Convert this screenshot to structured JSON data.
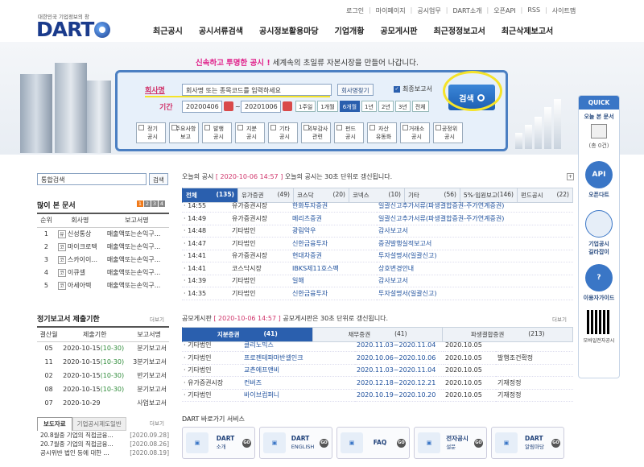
{
  "topbar": [
    "로그인",
    "마이페이지",
    "공시업무",
    "DART소개",
    "오픈API",
    "RSS",
    "사이트맵"
  ],
  "logo": {
    "sub": "대한민국 기업정보의 창",
    "name": "DART"
  },
  "nav": [
    "최근공시",
    "공시서류검색",
    "공시정보활용마당",
    "기업개황",
    "공모게시판",
    "최근정정보고서",
    "최근삭제보고서"
  ],
  "slogan": {
    "h1": "신속하고",
    "h2": "투명한 공시 !",
    "rest": "세계속의 초일류 자본시장을 만들어 나갑니다."
  },
  "search": {
    "company_label": "회사명",
    "company_value": "회사명 또는 종목코드를 입력하세요",
    "find_btn": "회사명찾기",
    "final_label": "최종보고서",
    "period_label": "기간",
    "start": "20200406",
    "end": "20201006",
    "periods": [
      "1주일",
      "1개월",
      "6개월",
      "1년",
      "2년",
      "3년",
      "전체"
    ],
    "periods_active": 2,
    "categories": [
      "정기\n공시",
      "주요사항\n보고",
      "발행\n공시",
      "지분\n공시",
      "기타\n공시",
      "외부감사\n관련",
      "펀드\n공시",
      "자산\n유동화",
      "거래소\n공시",
      "공정위\n공시"
    ],
    "search_btn": "검색"
  },
  "quick": {
    "title": "QUICK",
    "recent": "오늘 본 문서",
    "count": "(총 0건)",
    "api": "API",
    "api_label": "오픈다트",
    "guide1": "기업공시",
    "guide2": "길라잡이",
    "faq": "이용자가이드",
    "mobile": "모바일전자공시"
  },
  "left": {
    "search_value": "통합검색",
    "search_btn": "검색",
    "top_title": "많이 본 문서",
    "pages": [
      "1",
      "2",
      "3",
      "4"
    ],
    "top_cols": [
      "순위",
      "회사명",
      "보고서명"
    ],
    "top_rows": [
      {
        "rank": "1",
        "mk": "유",
        "co": "신성통상",
        "rep": "매출액또는손익구..."
      },
      {
        "rank": "2",
        "mk": "코",
        "co": "마이크로텍",
        "rep": "매출액또는손익구..."
      },
      {
        "rank": "3",
        "mk": "코",
        "co": "스카이이...",
        "rep": "매출액또는손익구..."
      },
      {
        "rank": "4",
        "mk": "코",
        "co": "이큐셀",
        "rep": "매출액또는손익구..."
      },
      {
        "rank": "5",
        "mk": "코",
        "co": "아세아텍",
        "rep": "매출액또는손익구..."
      }
    ],
    "deadline_title": "정기보고서 제출기한",
    "more": "더보기",
    "dl_cols": [
      "결산월",
      "제출기한",
      "보고서명"
    ],
    "dl_rows": [
      {
        "m": "05",
        "d": "2020-10-15",
        "t": "(10-30)",
        "r": "분기보고서"
      },
      {
        "m": "11",
        "d": "2020-10-15",
        "t": "(10-30)",
        "r": "3분기보고서"
      },
      {
        "m": "02",
        "d": "2020-10-15",
        "t": "(10-30)",
        "r": "반기보고서"
      },
      {
        "m": "08",
        "d": "2020-10-15",
        "t": "(10-30)",
        "r": "분기보고서"
      },
      {
        "m": "07",
        "d": "2020-10-29",
        "t": "",
        "r": "사업보고서"
      }
    ],
    "news_tabs": [
      "보도자료",
      "기업공시제도일반"
    ],
    "news": [
      {
        "t": "20.8월중 기업의 직접금융...",
        "d": "[2020.09.28]"
      },
      {
        "t": "20.7월중 기업의 직접금융...",
        "d": "[2020.08.26]"
      },
      {
        "t": "공시위반 법인 등에 대한 ...",
        "d": "[2020.08.19]"
      }
    ]
  },
  "today": {
    "title": "오늘의 공시",
    "stamp": "[ 2020-10-06 14:57 ]",
    "desc": "오늘의 공시는 30초 단위로 갱신됩니다.",
    "tabs": [
      {
        "n": "전체",
        "c": "(135)"
      },
      {
        "n": "유가증권",
        "c": "(49)"
      },
      {
        "n": "코스닥",
        "c": "(20)"
      },
      {
        "n": "코넥스",
        "c": "(10)"
      },
      {
        "n": "기타",
        "c": "(56)"
      },
      {
        "n": "5%·임원보고",
        "c": "(146)"
      },
      {
        "n": "펀드공시",
        "c": "(22)"
      }
    ],
    "rows": [
      {
        "time": "14:55",
        "mkt": "유가증권시장",
        "co": "한화투자증권",
        "rep": "일괄신고추가서류(파생결합증권-주가연계증권)"
      },
      {
        "time": "14:49",
        "mkt": "유가증권시장",
        "co": "메리츠증권",
        "rep": "일괄신고추가서류(파생결합증권-주가연계증권)"
      },
      {
        "time": "14:48",
        "mkt": "기타법인",
        "co": "광림악우",
        "rep": "감사보고서"
      },
      {
        "time": "14:47",
        "mkt": "기타법인",
        "co": "신한금융투자",
        "rep": "증권발행실적보고서"
      },
      {
        "time": "14:41",
        "mkt": "유가증권시장",
        "co": "현대차증권",
        "rep": "투자설명서(일괄신고)"
      },
      {
        "time": "14:41",
        "mkt": "코스닥시장",
        "co": "IBKS제11호스팩",
        "rep": "상호변경안내"
      },
      {
        "time": "14:39",
        "mkt": "기타법인",
        "co": "일해",
        "rep": "감사보고서"
      },
      {
        "time": "14:35",
        "mkt": "기타법인",
        "co": "신한금융투자",
        "rep": "투자설명서(일괄신고)"
      }
    ]
  },
  "ipo": {
    "title": "공모게시판",
    "stamp": "[ 2020-10-06 14:57 ]",
    "desc": "공모게시판은 30초 단위로 갱신됩니다.",
    "tabs": [
      {
        "n": "지분증권",
        "c": "(41)"
      },
      {
        "n": "채무증권",
        "c": "(41)"
      },
      {
        "n": "파생결합증권",
        "c": "(213)"
      }
    ],
    "rows": [
      {
        "mkt": "기타법인",
        "co": "클리노믹스",
        "p": "2020.11.03~2020.11.04",
        "d": "2020.10.05",
        "s": ""
      },
      {
        "mkt": "기타법인",
        "co": "프로젠테파마반셀인크",
        "p": "2020.10.06~2020.10.06",
        "d": "2020.10.05",
        "s": "발행조건확정"
      },
      {
        "mkt": "기타법인",
        "co": "교촌에프앤비",
        "p": "2020.11.03~2020.11.04",
        "d": "2020.10.05",
        "s": ""
      },
      {
        "mkt": "유가증권시장",
        "co": "컨버즈",
        "p": "2020.12.18~2020.12.21",
        "d": "2020.10.05",
        "s": "기재정정"
      },
      {
        "mkt": "기타법인",
        "co": "바이브컴퍼니",
        "p": "2020.10.19~2020.10.20",
        "d": "2020.10.05",
        "s": "기재정정"
      }
    ]
  },
  "services": {
    "title": "DART 바로가기 서비스",
    "items": [
      {
        "a": "DART",
        "b": "소개"
      },
      {
        "a": "DART",
        "b": "ENGLISH"
      },
      {
        "a": "FAQ",
        "b": ""
      },
      {
        "a": "전자공시",
        "b": "설문"
      },
      {
        "a": "DART",
        "b": "알림마당"
      }
    ],
    "go": "GO"
  }
}
